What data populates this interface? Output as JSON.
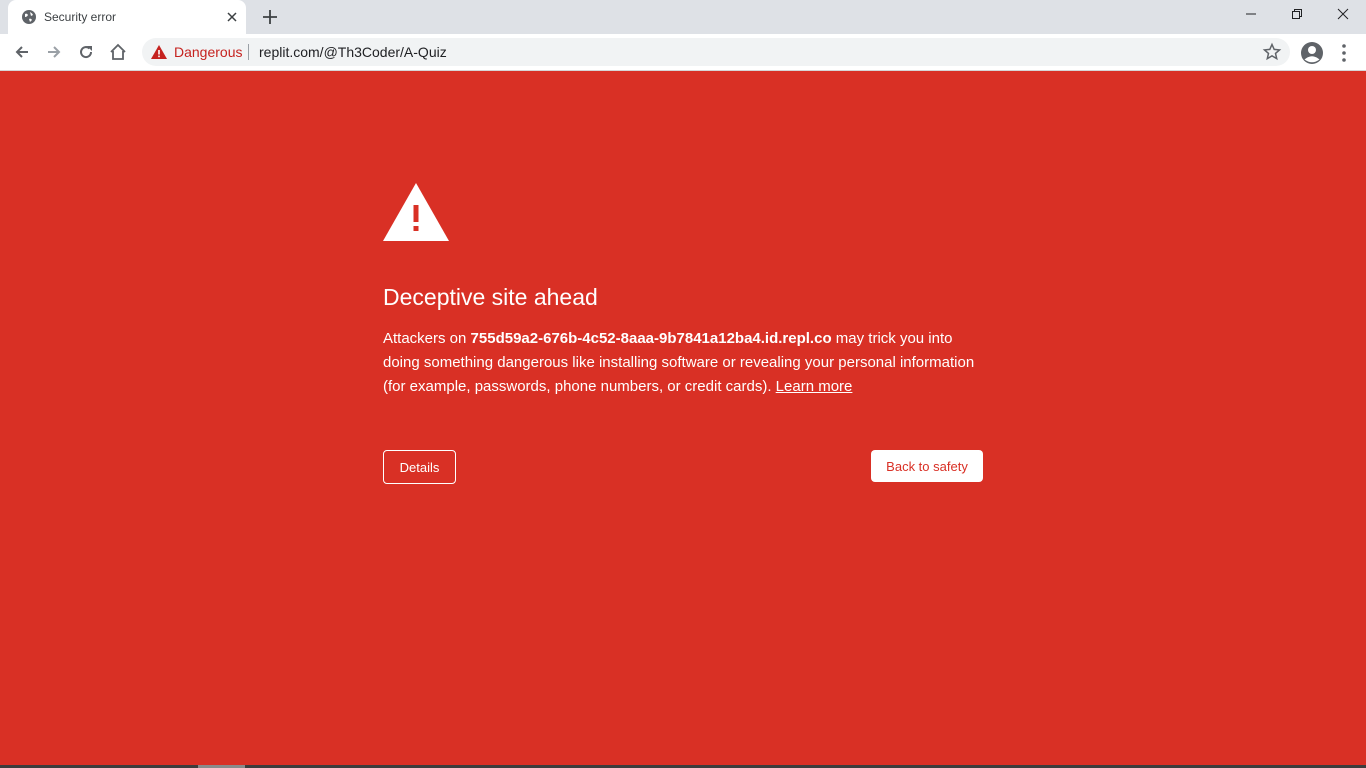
{
  "tab": {
    "title": "Security error",
    "favicon": "globe-icon",
    "close": "close-icon"
  },
  "window_controls": [
    "minimize-icon",
    "restore-icon",
    "close-icon"
  ],
  "toolbar": {
    "security_label": "Dangerous",
    "url": "replit.com/@Th3Coder/A-Quiz",
    "icons": [
      "back-icon",
      "forward-icon",
      "reload-icon",
      "home-icon",
      "warning-icon",
      "star-icon",
      "account-icon",
      "more-vert-icon"
    ]
  },
  "interstitial": {
    "heading": "Deceptive site ahead",
    "text_before": "Attackers on ",
    "host": "755d59a2-676b-4c52-8aaa-9b7841a12ba4.id.repl.co",
    "text_after": " may trick you into doing something dangerous like installing software or revealing your personal information (for example, passwords, phone numbers, or credit cards). ",
    "learn_more": "Learn more",
    "details_button": "Details",
    "safety_button": "Back to safety"
  },
  "colors": {
    "danger_background": "#d93025",
    "danger_text": "#c5221f",
    "tab_strip": "#dee1e6",
    "omnibox": "#f1f3f4"
  }
}
